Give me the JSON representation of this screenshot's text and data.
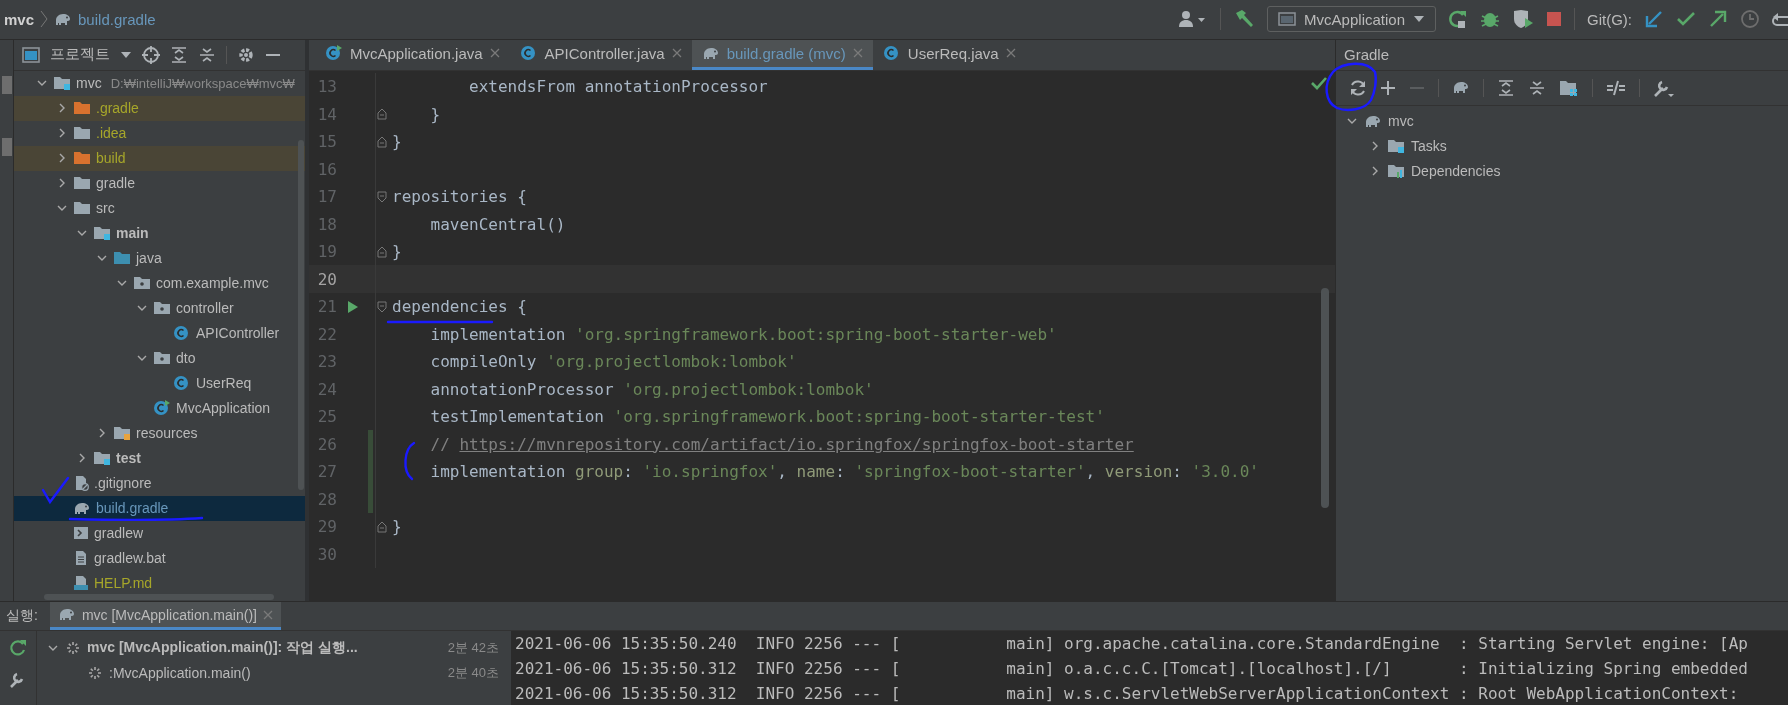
{
  "breadcrumb": [
    {
      "label": "mvc",
      "kind": "project"
    },
    {
      "label": "build.gradle",
      "kind": "gradle-file"
    }
  ],
  "toolbar": {
    "run_config": "MvcApplication",
    "git_label": "Git(G):"
  },
  "project_panel": {
    "title": "프로젝트",
    "tree": [
      {
        "label": "mvc",
        "path": "D:₩intelliJ₩workspace₩mvc₩",
        "kind": "module",
        "color": "#bbbbbb",
        "excluded": false,
        "expanded": true,
        "selected": false,
        "children": [
          {
            "label": ".gradle",
            "kind": "folder",
            "color": "#a6a62a",
            "excluded": true,
            "expanded": false,
            "selected": false
          },
          {
            "label": ".idea",
            "kind": "folder",
            "color": "#a6a62a",
            "excluded": false,
            "expanded": false,
            "selected": false
          },
          {
            "label": "build",
            "kind": "folder",
            "color": "#a6a62a",
            "excluded": true,
            "expanded": false,
            "selected": false
          },
          {
            "label": "gradle",
            "kind": "folder",
            "color": "#bbbbbb",
            "excluded": false,
            "expanded": false,
            "selected": false
          },
          {
            "label": "src",
            "kind": "folder",
            "color": "#bbbbbb",
            "excluded": false,
            "expanded": true,
            "selected": false,
            "children": [
              {
                "label": "main",
                "kind": "source-root",
                "color": "#bbbbbb",
                "excluded": false,
                "expanded": true,
                "selected": false,
                "children": [
                  {
                    "label": "java",
                    "kind": "source-folder",
                    "color": "#bbbbbb",
                    "excluded": false,
                    "expanded": true,
                    "selected": false,
                    "children": [
                      {
                        "label": "com.example.mvc",
                        "kind": "package",
                        "color": "#bbbbbb",
                        "excluded": false,
                        "expanded": true,
                        "selected": false,
                        "children": [
                          {
                            "label": "controller",
                            "kind": "package",
                            "color": "#bbbbbb",
                            "excluded": false,
                            "expanded": true,
                            "selected": false,
                            "children": [
                              {
                                "label": "APIController",
                                "kind": "class",
                                "color": "#bbbbbb",
                                "excluded": false,
                                "selected": false
                              }
                            ]
                          },
                          {
                            "label": "dto",
                            "kind": "package",
                            "color": "#bbbbbb",
                            "excluded": false,
                            "expanded": true,
                            "selected": false,
                            "children": [
                              {
                                "label": "UserReq",
                                "kind": "class",
                                "color": "#bbbbbb",
                                "excluded": false,
                                "selected": false
                              }
                            ]
                          },
                          {
                            "label": "MvcApplication",
                            "kind": "main-class",
                            "color": "#bbbbbb",
                            "excluded": false,
                            "selected": false
                          }
                        ]
                      }
                    ]
                  },
                  {
                    "label": "resources",
                    "kind": "resource-folder",
                    "color": "#bbbbbb",
                    "excluded": false,
                    "expanded": false,
                    "selected": false
                  }
                ]
              },
              {
                "label": "test",
                "kind": "source-root",
                "color": "#bbbbbb",
                "excluded": false,
                "expanded": false,
                "selected": false
              }
            ]
          },
          {
            "label": ".gitignore",
            "kind": "ignore-file",
            "color": "#bbbbbb",
            "excluded": false,
            "selected": false
          },
          {
            "label": "build.gradle",
            "kind": "gradle-file",
            "color": "#6897bb",
            "excluded": false,
            "selected": true
          },
          {
            "label": "gradlew",
            "kind": "script",
            "color": "#bbbbbb",
            "excluded": false,
            "selected": false
          },
          {
            "label": "gradlew.bat",
            "kind": "text-file",
            "color": "#bbbbbb",
            "excluded": false,
            "selected": false
          },
          {
            "label": "HELP.md",
            "kind": "markdown",
            "color": "#a6a62a",
            "excluded": false,
            "selected": false
          }
        ]
      }
    ]
  },
  "editor": {
    "tabs": [
      {
        "label": "MvcApplication.java",
        "kind": "main-class",
        "modified": false,
        "selected": false
      },
      {
        "label": "APIController.java",
        "kind": "class",
        "modified": false,
        "selected": false
      },
      {
        "label": "build.gradle (mvc)",
        "kind": "gradle-file",
        "modified": true,
        "selected": true
      },
      {
        "label": "UserReq.java",
        "kind": "class",
        "modified": false,
        "selected": false
      }
    ],
    "lines": [
      {
        "number": "13",
        "current": false,
        "changed": false,
        "fold_start": false,
        "fold_end": false,
        "runnable": false,
        "tokens": [
          {
            "text": "        extendsFrom annotationProcessor",
            "kind": "text"
          }
        ]
      },
      {
        "number": "14",
        "current": false,
        "changed": false,
        "fold_start": false,
        "fold_end": true,
        "runnable": false,
        "tokens": [
          {
            "text": "    }",
            "kind": "text"
          }
        ]
      },
      {
        "number": "15",
        "current": false,
        "changed": false,
        "fold_start": false,
        "fold_end": true,
        "runnable": false,
        "tokens": [
          {
            "text": "}",
            "kind": "text"
          }
        ]
      },
      {
        "number": "16",
        "current": false,
        "changed": false,
        "fold_start": false,
        "fold_end": false,
        "runnable": false
      },
      {
        "number": "17",
        "current": false,
        "changed": false,
        "fold_start": true,
        "fold_end": false,
        "runnable": false,
        "tokens": [
          {
            "text": "repositories {",
            "kind": "text"
          }
        ]
      },
      {
        "number": "18",
        "current": false,
        "changed": false,
        "fold_start": false,
        "fold_end": false,
        "runnable": false,
        "tokens": [
          {
            "text": "    mavenCentral()",
            "kind": "text"
          }
        ]
      },
      {
        "number": "19",
        "current": false,
        "changed": false,
        "fold_start": false,
        "fold_end": true,
        "runnable": false,
        "tokens": [
          {
            "text": "}",
            "kind": "text"
          }
        ]
      },
      {
        "number": "20",
        "current": true,
        "changed": false,
        "fold_start": false,
        "fold_end": false,
        "runnable": false
      },
      {
        "number": "21",
        "current": false,
        "changed": false,
        "fold_start": true,
        "fold_end": false,
        "runnable": true,
        "tokens": [
          {
            "text": "dependencies {",
            "kind": "text"
          }
        ]
      },
      {
        "number": "22",
        "current": false,
        "changed": false,
        "fold_start": false,
        "fold_end": false,
        "runnable": false,
        "tokens": [
          {
            "text": "    implementation ",
            "kind": "text"
          },
          {
            "text": "'org.springframework.boot:spring-boot-starter-web'",
            "kind": "string"
          }
        ]
      },
      {
        "number": "23",
        "current": false,
        "changed": false,
        "fold_start": false,
        "fold_end": false,
        "runnable": false,
        "tokens": [
          {
            "text": "    compileOnly ",
            "kind": "text"
          },
          {
            "text": "'org.projectlombok:lombok'",
            "kind": "string"
          }
        ]
      },
      {
        "number": "24",
        "current": false,
        "changed": false,
        "fold_start": false,
        "fold_end": false,
        "runnable": false,
        "tokens": [
          {
            "text": "    annotationProcessor ",
            "kind": "text"
          },
          {
            "text": "'org.projectlombok:lombok'",
            "kind": "string"
          }
        ]
      },
      {
        "number": "25",
        "current": false,
        "changed": false,
        "fold_start": false,
        "fold_end": false,
        "runnable": false,
        "tokens": [
          {
            "text": "    testImplementation ",
            "kind": "text"
          },
          {
            "text": "'org.springframework.boot:spring-boot-starter-test'",
            "kind": "string"
          }
        ]
      },
      {
        "number": "26",
        "current": false,
        "changed": true,
        "fold_start": false,
        "fold_end": false,
        "runnable": false,
        "tokens": [
          {
            "text": "    // ",
            "kind": "comment"
          },
          {
            "text": "https://mvnrepository.com/artifact/io.springfox/springfox-boot-starter",
            "kind": "link"
          }
        ]
      },
      {
        "number": "27",
        "current": false,
        "changed": true,
        "fold_start": false,
        "fold_end": false,
        "runnable": false,
        "tokens": [
          {
            "text": "    implementation ",
            "kind": "text"
          },
          {
            "text": "group",
            "kind": "param"
          },
          {
            "text": ": ",
            "kind": "text"
          },
          {
            "text": "'io.springfox'",
            "kind": "string"
          },
          {
            "text": ", ",
            "kind": "text"
          },
          {
            "text": "name",
            "kind": "param"
          },
          {
            "text": ": ",
            "kind": "text"
          },
          {
            "text": "'springfox-boot-starter'",
            "kind": "string"
          },
          {
            "text": ", ",
            "kind": "text"
          },
          {
            "text": "version",
            "kind": "param"
          },
          {
            "text": ": ",
            "kind": "text"
          },
          {
            "text": "'3.0.0'",
            "kind": "string"
          }
        ]
      },
      {
        "number": "28",
        "current": false,
        "changed": true,
        "fold_start": false,
        "fold_end": false,
        "runnable": false
      },
      {
        "number": "29",
        "current": false,
        "changed": false,
        "fold_start": false,
        "fold_end": true,
        "runnable": false,
        "tokens": [
          {
            "text": "}",
            "kind": "text"
          }
        ]
      },
      {
        "number": "30",
        "current": false,
        "changed": false,
        "fold_start": false,
        "fold_end": false,
        "runnable": false
      }
    ]
  },
  "gradle_panel": {
    "title": "Gradle",
    "tree": [
      {
        "label": "mvc",
        "kind": "project",
        "expanded": true,
        "children": [
          {
            "label": "Tasks",
            "kind": "tasks",
            "expanded": false
          },
          {
            "label": "Dependencies",
            "kind": "dependencies",
            "expanded": false
          }
        ]
      }
    ]
  },
  "run_panel": {
    "label": "실행:",
    "tabs": [
      {
        "label": "mvc [MvcApplication.main()]",
        "selected": true
      }
    ],
    "tree": [
      {
        "label": "mvc [MvcApplication.main()]: 작업 실행...",
        "time": "2분 42초",
        "expanded": true,
        "children": [
          {
            "label": ":MvcApplication.main()",
            "time": "2분 40초"
          }
        ]
      }
    ],
    "console": [
      "2021-06-06 15:35:50.240  INFO 2256 --- [           main] org.apache.catalina.core.StandardEngine  : Starting Servlet engine: [Ap",
      "2021-06-06 15:35:50.312  INFO 2256 --- [           main] o.a.c.c.C.[Tomcat].[localhost].[/]       : Initializing Spring embedded",
      "2021-06-06 15:35:50.312  INFO 2256 --- [           main] w.s.c.ServletWebServerApplicationContext : Root WebApplicationContext:"
    ]
  }
}
